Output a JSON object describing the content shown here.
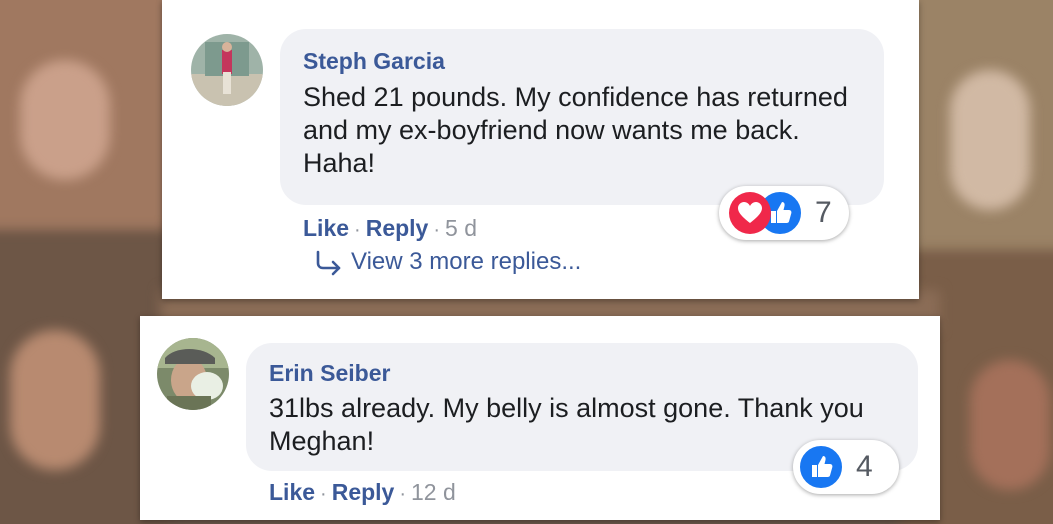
{
  "comments": [
    {
      "author": "Steph Garcia",
      "text": "Shed 21 pounds. My confidence has returned and my ex-boyfriend now wants me back. Haha!",
      "actions": {
        "like": "Like",
        "reply": "Reply",
        "separator": "·",
        "time": "5 d"
      },
      "reactions": {
        "icons": [
          "heart-icon",
          "thumbs-up-icon"
        ],
        "count": "7"
      },
      "more_replies": "View 3 more replies..."
    },
    {
      "author": "Erin Seiber",
      "text": "31lbs already. My belly is almost gone. Thank you Meghan!",
      "actions": {
        "like": "Like",
        "reply": "Reply",
        "separator": "·",
        "time": "12 d"
      },
      "reactions": {
        "icons": [
          "thumbs-up-icon"
        ],
        "count": "4"
      }
    }
  ],
  "colors": {
    "author": "#3b5998",
    "bubble": "#f0f1f5",
    "like_blue": "#1877f2",
    "love_red": "#f0284a"
  }
}
